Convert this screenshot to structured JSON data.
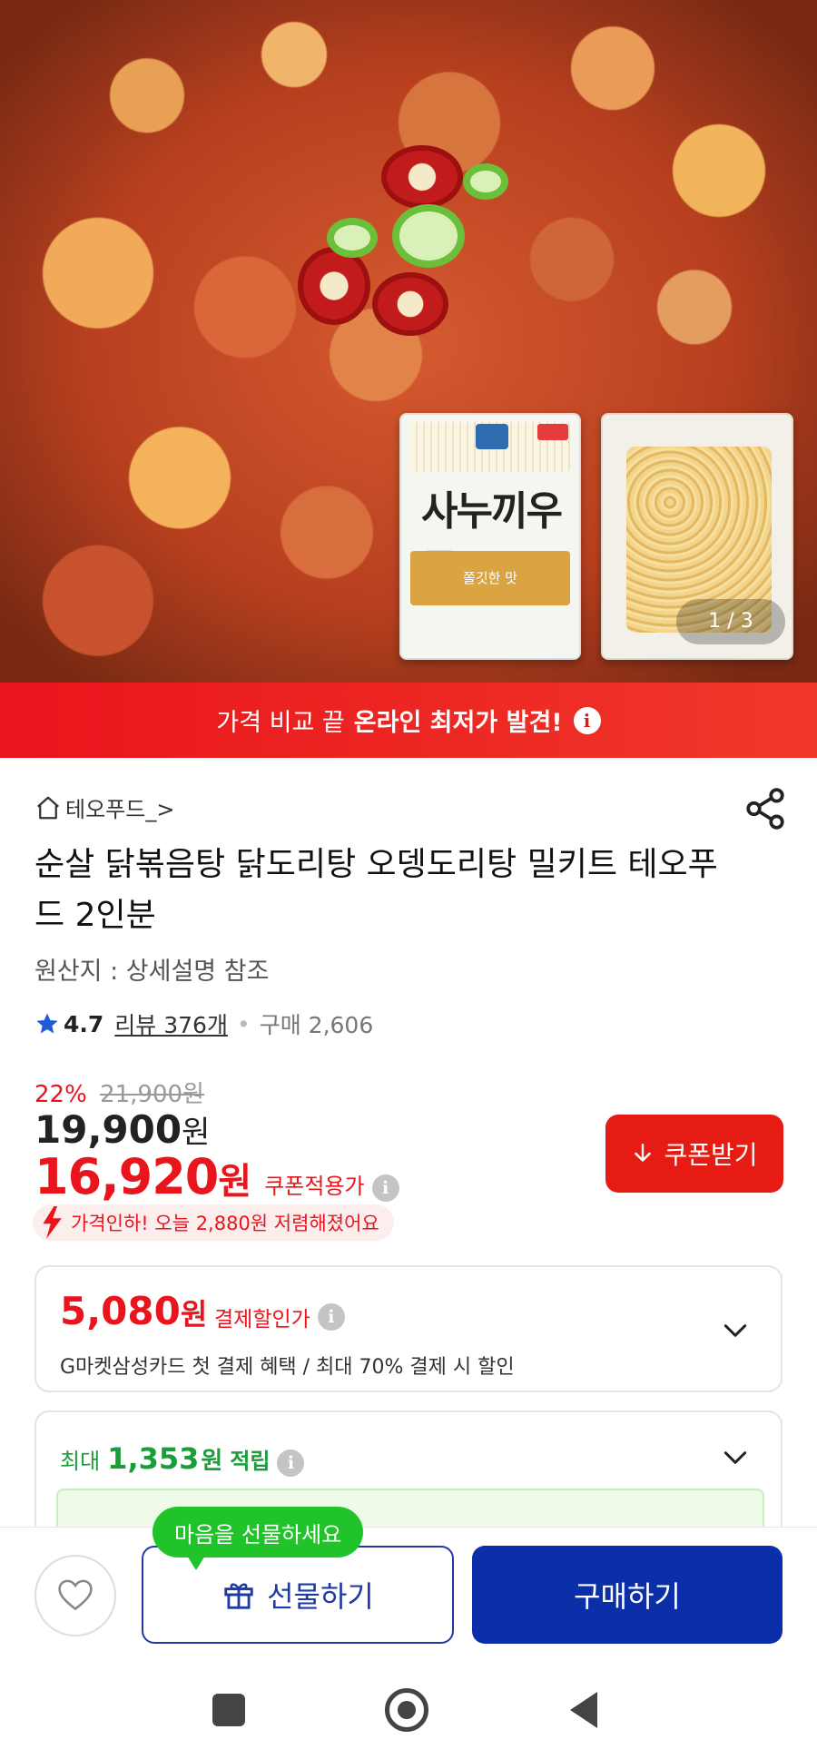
{
  "gallery": {
    "page_indicator": "1 / 3",
    "udon_package_text": "사누끼우동",
    "udon_band_text": "쫄깃한 맛"
  },
  "promo_banner": {
    "text_prefix": "가격 비교 끝",
    "text_bold": "온라인 최저가 발견!",
    "info_glyph": "i"
  },
  "seller": {
    "name": "테오푸드_>"
  },
  "product": {
    "title": "순살 닭볶음탕 닭도리탕 오뎅도리탕 밀키트 테오푸드 2인분",
    "origin": "원산지 : 상세설명 참조"
  },
  "rating": {
    "score": "4.7",
    "reviews": "리뷰 376개",
    "purchases": "구매 2,606",
    "star_color": "#1e5cd6"
  },
  "pricing": {
    "discount_pct": "22%",
    "original_price": "21,900원",
    "sale_value": "19,900",
    "sale_unit": "원",
    "coupon_value": "16,920",
    "coupon_unit": "원",
    "coupon_label": "쿠폰적용가",
    "coupon_button": "쿠폰받기",
    "price_drop_note": "가격인하! 오늘 2,880원 저렴해졌어요"
  },
  "payment_discount": {
    "amount_value": "5,080",
    "amount_unit": "원",
    "label": "결제할인가",
    "description": "G마켓삼성카드 첫 결제 혜택 / 최대 70% 결제 시 할인"
  },
  "points": {
    "prefix": "최대",
    "amount": "1,353",
    "unit": "원",
    "label": "적립"
  },
  "bottom_bar": {
    "gift_tooltip": "마음을 선물하세요",
    "gift_button": "선물하기",
    "buy_button": "구매하기"
  },
  "colors": {
    "accent_red": "#e9141c",
    "primary_blue": "#0a2fa8",
    "points_green": "#1a9d3b"
  }
}
